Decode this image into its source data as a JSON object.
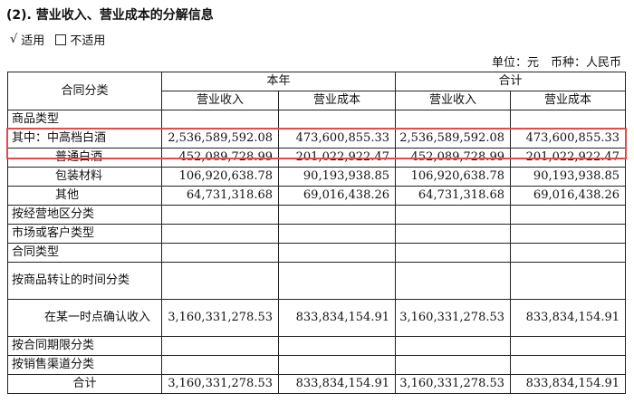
{
  "section_title": "(2). 营业收入、营业成本的分解信息",
  "applicability": {
    "check_mark": "√",
    "applicable": "适用",
    "not_applicable": "不适用"
  },
  "unit_line": "单位：元　币种：人民币",
  "table": {
    "header": {
      "contract_class": "合同分类",
      "current_year": "本年",
      "total": "合计",
      "revenue": "营业收入",
      "cost": "营业成本"
    },
    "rows": [
      {
        "label": "商品类型",
        "cy_rev": "",
        "cy_cost": "",
        "t_rev": "",
        "t_cost": ""
      },
      {
        "label": "其中：中高档白酒",
        "cy_rev": "2,536,589,592.08",
        "cy_cost": "473,600,855.33",
        "t_rev": "2,536,589,592.08",
        "t_cost": "473,600,855.33"
      },
      {
        "label": "普通白酒",
        "cy_rev": "452,089,728.99",
        "cy_cost": "201,022,922.47",
        "t_rev": "452,089,728.99",
        "t_cost": "201,022,922.47"
      },
      {
        "label": "包装材料",
        "cy_rev": "106,920,638.78",
        "cy_cost": "90,193,938.85",
        "t_rev": "106,920,638.78",
        "t_cost": "90,193,938.85"
      },
      {
        "label": "其他",
        "cy_rev": "64,731,318.68",
        "cy_cost": "69,016,438.26",
        "t_rev": "64,731,318.68",
        "t_cost": "69,016,438.26"
      },
      {
        "label": "按经营地区分类",
        "cy_rev": "",
        "cy_cost": "",
        "t_rev": "",
        "t_cost": ""
      },
      {
        "label": "市场或客户类型",
        "cy_rev": "",
        "cy_cost": "",
        "t_rev": "",
        "t_cost": ""
      },
      {
        "label": "合同类型",
        "cy_rev": "",
        "cy_cost": "",
        "t_rev": "",
        "t_cost": ""
      },
      {
        "label": "按商品转让的时间分类",
        "cy_rev": "",
        "cy_cost": "",
        "t_rev": "",
        "t_cost": ""
      },
      {
        "label": "在某一时点确认收入",
        "cy_rev": "3,160,331,278.53",
        "cy_cost": "833,834,154.91",
        "t_rev": "3,160,331,278.53",
        "t_cost": "833,834,154.91"
      },
      {
        "label": "按合同期限分类",
        "cy_rev": "",
        "cy_cost": "",
        "t_rev": "",
        "t_cost": ""
      },
      {
        "label": "按销售渠道分类",
        "cy_rev": "",
        "cy_cost": "",
        "t_rev": "",
        "t_cost": ""
      },
      {
        "label": "合计",
        "cy_rev": "3,160,331,278.53",
        "cy_cost": "833,834,154.91",
        "t_rev": "3,160,331,278.53",
        "t_cost": "833,834,154.91"
      }
    ]
  },
  "highlight_color": "#e34b4b"
}
